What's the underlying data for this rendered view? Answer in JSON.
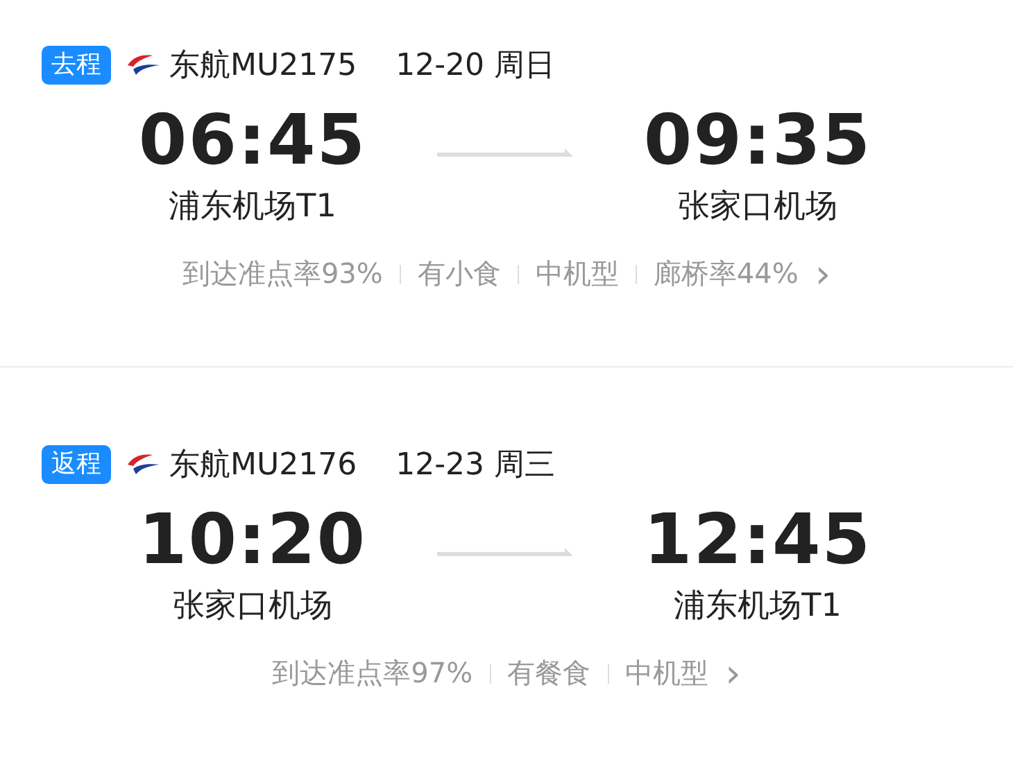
{
  "trips": [
    {
      "badge": "去程",
      "flight": "东航MU2175",
      "date": "12-20 周日",
      "depart_time": "06:45",
      "depart_airport": "浦东机场T1",
      "arrive_time": "09:35",
      "arrive_airport": "张家口机场",
      "info": [
        "到达准点率93%",
        "有小食",
        "中机型",
        "廊桥率44%"
      ],
      "chevron": "›"
    },
    {
      "badge": "返程",
      "flight": "东航MU2176",
      "date": "12-23 周三",
      "depart_time": "10:20",
      "depart_airport": "张家口机场",
      "arrive_time": "12:45",
      "arrive_airport": "浦东机场T1",
      "info": [
        "到达准点率97%",
        "有餐食",
        "中机型"
      ],
      "chevron": "›"
    }
  ]
}
